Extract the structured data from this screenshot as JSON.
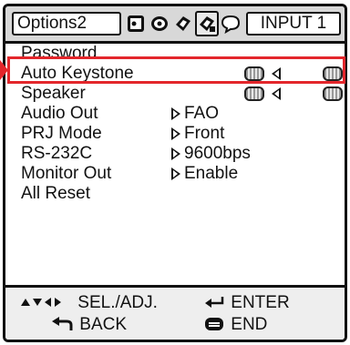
{
  "header": {
    "tab_title": "Options2",
    "input_label": "INPUT 1",
    "icons": [
      "picture-menu-icon",
      "sound-menu-icon",
      "options1-menu-icon",
      "options2-menu-icon",
      "language-menu-icon"
    ]
  },
  "menu": {
    "rows": [
      {
        "label": "Password"
      },
      {
        "label": "Auto Keystone",
        "control": "on-off-toggle"
      },
      {
        "label": "Speaker",
        "control": "on-off-toggle"
      },
      {
        "label": "Audio Out",
        "value": "FAO"
      },
      {
        "label": "PRJ Mode",
        "value": "Front"
      },
      {
        "label": "RS-232C",
        "value": "9600bps"
      },
      {
        "label": "Monitor Out",
        "value": "Enable"
      },
      {
        "label": "All Reset"
      }
    ]
  },
  "footer": {
    "sel_adj": "SEL./ADJ.",
    "enter": "ENTER",
    "back": "BACK",
    "end": "END"
  },
  "colors": {
    "highlight": "#e3262b",
    "header_bg": "#d8d8d8"
  }
}
